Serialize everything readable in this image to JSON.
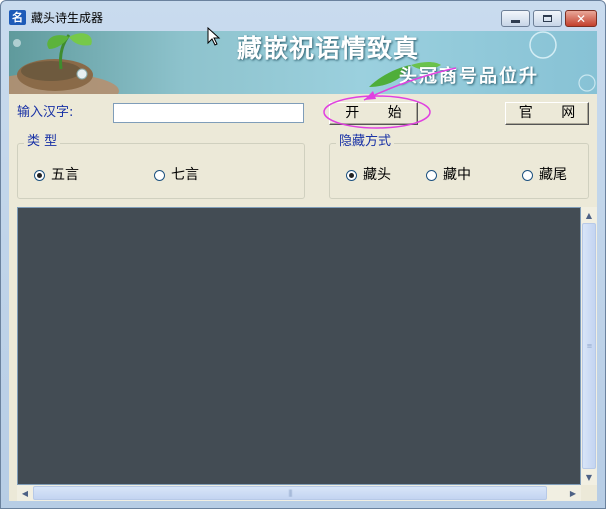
{
  "window": {
    "title": "藏头诗生成器",
    "icon_char": "名",
    "controls": [
      "minimize-icon",
      "maximize-icon",
      "close-icon"
    ]
  },
  "banner": {
    "line1": "藏嵌祝语情致真",
    "line2": "头冠商号品位升"
  },
  "input": {
    "label": "输入汉字:",
    "value": "",
    "placeholder": ""
  },
  "buttons": {
    "start": "开 始",
    "website": "官 网"
  },
  "type_group": {
    "legend": "类    型",
    "options": [
      {
        "label": "五言",
        "selected": true
      },
      {
        "label": "七言",
        "selected": false
      }
    ]
  },
  "hide_group": {
    "legend": "隐藏方式",
    "options": [
      {
        "label": "藏头",
        "selected": true
      },
      {
        "label": "藏中",
        "selected": false
      },
      {
        "label": "藏尾",
        "selected": false
      }
    ]
  },
  "output": {
    "text": ""
  },
  "colors": {
    "label_text": "#1932a6",
    "output_background": "#434c54",
    "annotation": "#e040e0",
    "face": "#ece9d8"
  }
}
